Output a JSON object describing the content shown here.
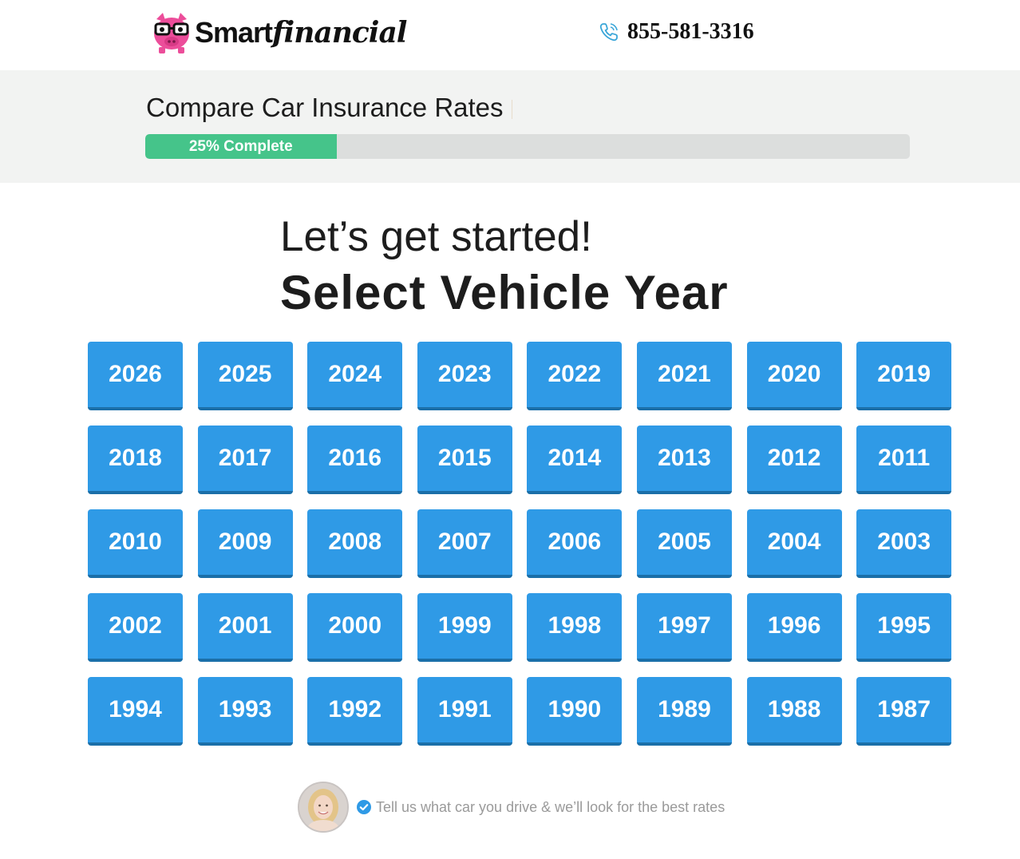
{
  "brand": {
    "name_part1": "Smart",
    "name_part2": "financial",
    "logo_icon": "pig-with-glasses-icon",
    "logo_color": "#ec4d9a"
  },
  "header": {
    "phone_icon": "phone-ringing-icon",
    "phone_number": "855-581-3316",
    "phone_icon_color": "#3aa6d8"
  },
  "progress": {
    "title": "Compare Car Insurance Rates",
    "percent": 25,
    "label": "25% Complete",
    "fill_color": "#45c48a"
  },
  "main": {
    "greeting": "Let’s get started!",
    "heading": "Select Vehicle Year",
    "button_color": "#2f9ae6",
    "years": [
      "2026",
      "2025",
      "2024",
      "2023",
      "2022",
      "2021",
      "2020",
      "2019",
      "2018",
      "2017",
      "2016",
      "2015",
      "2014",
      "2013",
      "2012",
      "2011",
      "2010",
      "2009",
      "2008",
      "2007",
      "2006",
      "2005",
      "2004",
      "2003",
      "2002",
      "2001",
      "2000",
      "1999",
      "1998",
      "1997",
      "1996",
      "1995",
      "1994",
      "1993",
      "1992",
      "1991",
      "1990",
      "1989",
      "1988",
      "1987"
    ]
  },
  "footer": {
    "avatar": "agent-avatar",
    "check_icon": "check-circle-icon",
    "message": "Tell us what car you drive & we’ll look for the best rates"
  }
}
